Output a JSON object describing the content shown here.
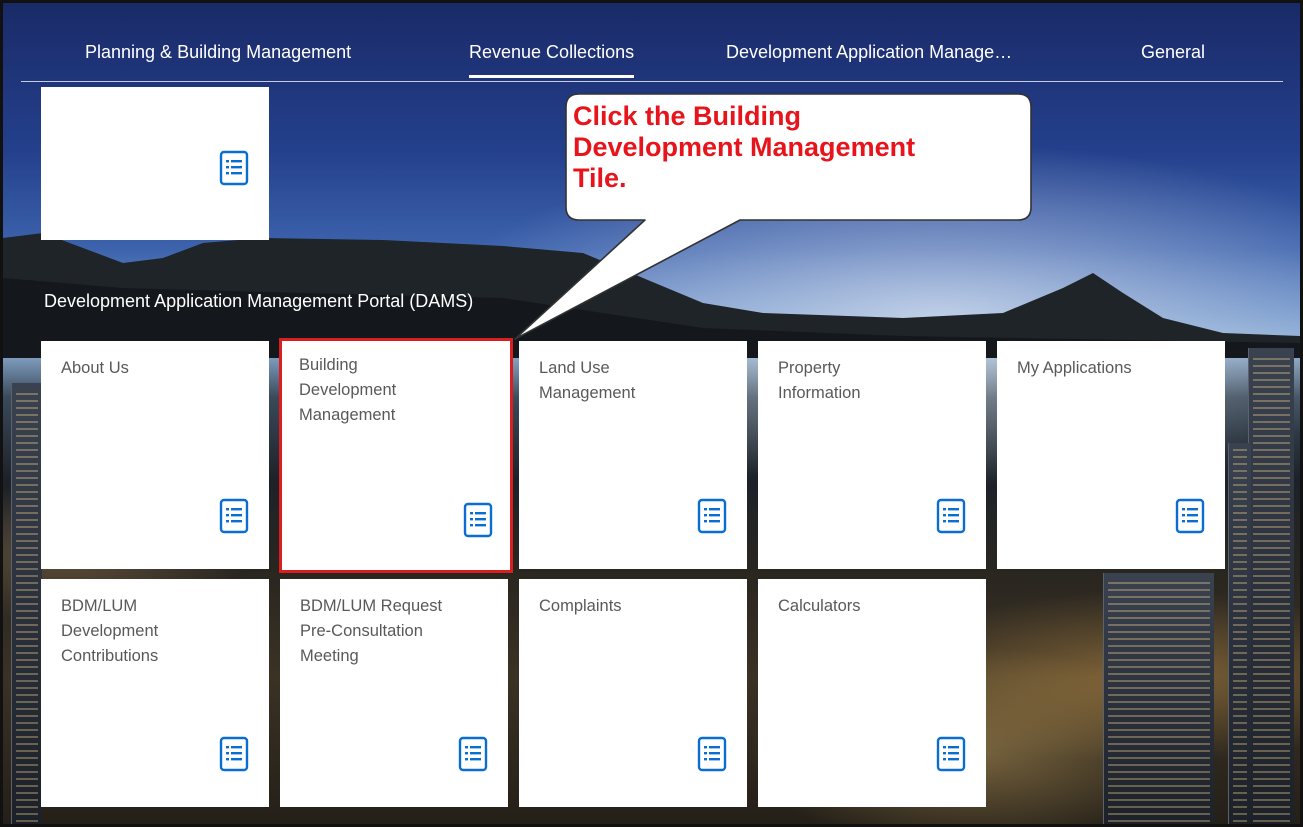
{
  "nav": {
    "items": [
      {
        "label": "Planning & Building Management"
      },
      {
        "label": "Revenue Collections"
      },
      {
        "label": "Development Application Manage…"
      },
      {
        "label": "General"
      }
    ],
    "active_index": 1
  },
  "top_tile": {
    "label": ""
  },
  "section": {
    "title": "Development Application Management Portal (DAMS)"
  },
  "tiles": [
    {
      "label": "About Us"
    },
    {
      "label": "Building\nDevelopment\nManagement"
    },
    {
      "label": "Land Use\nManagement"
    },
    {
      "label": "Property\nInformation"
    },
    {
      "label": "My Applications"
    },
    {
      "label": "BDM/LUM\nDevelopment\nContributions"
    },
    {
      "label": "BDM/LUM Request\nPre-Consultation\nMeeting"
    },
    {
      "label": "Complaints"
    },
    {
      "label": "Calculators"
    }
  ],
  "callout": {
    "text": "Click the Building\nDevelopment Management\nTile."
  },
  "colors": {
    "icon": "#0a6ed1",
    "tile_text": "#595959",
    "highlight_border": "#d81e1e",
    "callout_text": "#e8141b"
  },
  "icons": {
    "tile": "document-list-icon"
  }
}
